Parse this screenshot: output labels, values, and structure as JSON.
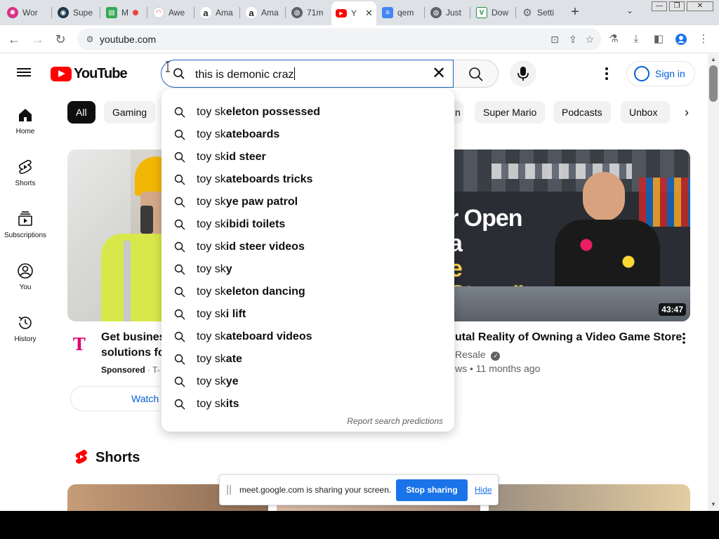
{
  "browser": {
    "tabs": [
      {
        "label": "Wor",
        "favicon": "spiral-icon",
        "color": "#d63384"
      },
      {
        "label": "Supe",
        "favicon": "eye-icon",
        "color": "#1b3a4b"
      },
      {
        "label": "M",
        "favicon": "chart-icon",
        "color": "#34a853"
      },
      {
        "label": "Awe",
        "favicon": "chart-icon",
        "color": "#e8453c"
      },
      {
        "label": "Ama",
        "favicon": "amazon-icon",
        "color": "#222222"
      },
      {
        "label": "Ama",
        "favicon": "amazon-icon",
        "color": "#222222"
      },
      {
        "label": "71m",
        "favicon": "globe-icon",
        "color": "#5f6368"
      },
      {
        "label": "Y",
        "favicon": "youtube-icon",
        "color": "#ff0000"
      },
      {
        "label": "qem",
        "favicon": "doc-icon",
        "color": "#4285f4"
      },
      {
        "label": "Just",
        "favicon": "globe-icon",
        "color": "#5f6368"
      },
      {
        "label": "Dow",
        "favicon": "v-icon",
        "color": "#1e8e3e"
      },
      {
        "label": "Setti",
        "favicon": "gear-icon",
        "color": "#5f6368"
      }
    ],
    "url": "youtube.com"
  },
  "youtube": {
    "logo_text": "YouTube",
    "search_value": "this is demonic craz",
    "signin_label": "Sign in",
    "guide": [
      {
        "label": "Home"
      },
      {
        "label": "Shorts"
      },
      {
        "label": "Subscriptions"
      },
      {
        "label": "You"
      },
      {
        "label": "History"
      }
    ],
    "chips": [
      "All",
      "Gaming",
      "Super Mario",
      "Podcasts",
      "Unbox"
    ],
    "chip_partial": "n",
    "video1": {
      "title_line1": "Get busines",
      "title_line2": "solutions fo",
      "sponsored": "Sponsored",
      "sponsor_trunc": "· T-",
      "watch_label": "Watch"
    },
    "video2": {
      "title": "utal Reality of Owning a Video Game Store",
      "channel": "Resale",
      "meta": "ws • 11 months ago",
      "duration": "43:47",
      "thumb_text_line1": "r Open a",
      "thumb_text_line2": "e Store.\""
    },
    "shorts_title": "Shorts",
    "suggestions": [
      {
        "prefix": "toy sk",
        "rest": "eleton possessed"
      },
      {
        "prefix": "toy sk",
        "rest": "ateboards"
      },
      {
        "prefix": "toy sk",
        "rest": "id steer"
      },
      {
        "prefix": "toy sk",
        "rest": "ateboards tricks"
      },
      {
        "prefix": "toy sk",
        "rest": "ye paw patrol"
      },
      {
        "prefix": "toy sk",
        "rest": "ibidi toilets"
      },
      {
        "prefix": "toy sk",
        "rest": "id steer videos"
      },
      {
        "prefix": "toy sk",
        "rest": "y"
      },
      {
        "prefix": "toy sk",
        "rest": "eleton dancing"
      },
      {
        "prefix": "toy sk",
        "rest": "i lift"
      },
      {
        "prefix": "toy sk",
        "rest": "ateboard videos"
      },
      {
        "prefix": "toy sk",
        "rest": "ate"
      },
      {
        "prefix": "toy sk",
        "rest": "ye"
      },
      {
        "prefix": "toy sk",
        "rest": "its"
      }
    ],
    "report_label": "Report search predictions"
  },
  "sharebar": {
    "message": "meet.google.com is sharing your screen.",
    "stop_label": "Stop sharing",
    "hide_label": "Hide"
  }
}
